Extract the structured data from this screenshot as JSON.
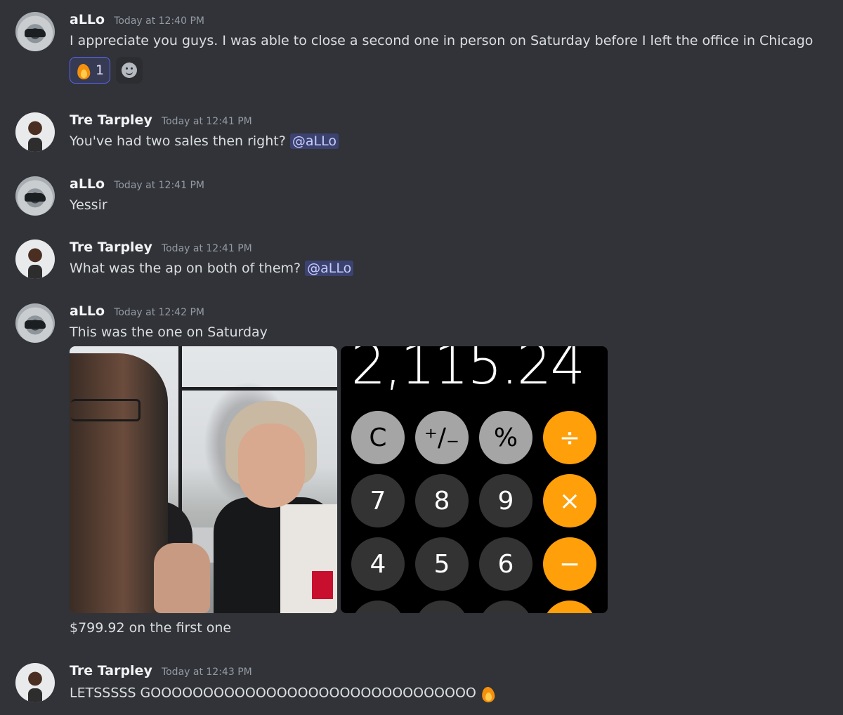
{
  "messages": [
    {
      "username": "aLLo",
      "timestamp": "Today at 12:40 PM",
      "text": "I appreciate you guys. I was able to close a second one in person on Saturday before I left the office in Chicago",
      "reaction_count": "1"
    },
    {
      "username": "Tre Tarpley",
      "timestamp": "Today at 12:41 PM",
      "text": "You've had two sales then right?",
      "mention": "@aLLo"
    },
    {
      "username": "aLLo",
      "timestamp": "Today at 12:41 PM",
      "text": "Yessir"
    },
    {
      "username": "Tre Tarpley",
      "timestamp": "Today at 12:41 PM",
      "text": "What was the ap on both of them?",
      "mention": "@aLLo"
    },
    {
      "username": "aLLo",
      "timestamp": "Today at 12:42 PM",
      "text": "This was the one on Saturday",
      "caption": "$799.92 on the first one"
    },
    {
      "username": "Tre Tarpley",
      "timestamp": "Today at 12:43 PM",
      "text": "LETSSSSS GOOOOOOOOOOOOOOOOOOOOOOOOOOOOOOO"
    }
  ],
  "calculator": {
    "display": "2,115.24",
    "keys": [
      "C",
      "⁺∕₋",
      "%",
      "÷",
      "7",
      "8",
      "9",
      "×",
      "4",
      "5",
      "6",
      "−"
    ]
  },
  "icons": {
    "reaction": "fire-emoji-icon",
    "add_reaction": "add-reaction-icon"
  },
  "colors": {
    "background": "#313338",
    "mention_bg": "#3c4270",
    "reaction_border": "#5865f2",
    "calc_orange": "#ff9f0a"
  }
}
